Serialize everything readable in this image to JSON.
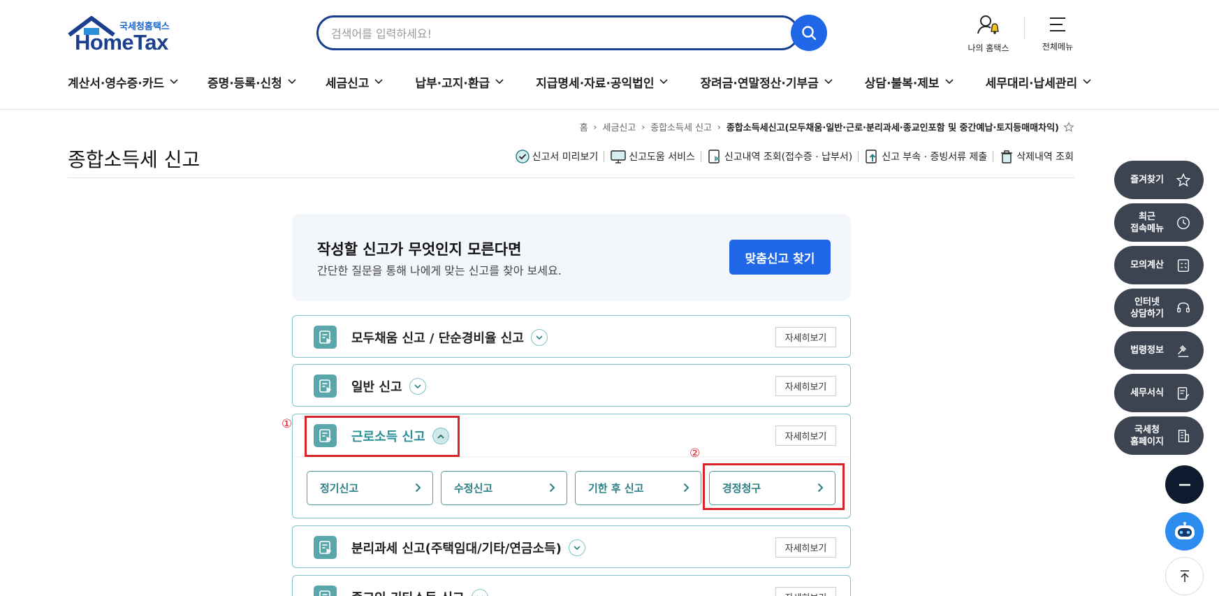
{
  "header": {
    "logo_sub": "국세청홈택스",
    "logo_main": "HomeTax",
    "search_placeholder": "검색어를 입력하세요!",
    "my_hometax": "나의 홈택스",
    "all_menu": "전체메뉴"
  },
  "gnb": [
    "계산서·영수증·카드",
    "증명·등록·신청",
    "세금신고",
    "납부·고지·환급",
    "지급명세·자료·공익법인",
    "장려금·연말정산·기부금",
    "상담·불복·제보",
    "세무대리·납세관리"
  ],
  "breadcrumb": {
    "items": [
      "홈",
      "세금신고",
      "종합소득세 신고"
    ],
    "current": "종합소득세신고(모두채움·일반·근로·분리과세·종교인포함 및 중간예납·토지등매매차익)"
  },
  "page": {
    "title": "종합소득세 신고",
    "tools": [
      "신고서 미리보기",
      "신고도움 서비스",
      "신고내역 조회(접수증 · 납부서)",
      "신고 부속 · 증빙서류 제출",
      "삭제내역 조회"
    ]
  },
  "promo": {
    "title": "작성할 신고가 무엇인지 모른다면",
    "desc": "간단한 질문을 통해 나에게 맞는 신고를 찾아 보세요.",
    "button": "맞춤신고 찾기"
  },
  "accordion": {
    "detail_label": "자세히보기",
    "items": [
      {
        "title": "모두채움 신고 / 단순경비율 신고",
        "open": false
      },
      {
        "title": "일반 신고",
        "open": false
      },
      {
        "title": "근로소득 신고",
        "open": true,
        "sub": [
          "정기신고",
          "수정신고",
          "기한 후 신고",
          "경정청구"
        ]
      },
      {
        "title": "분리과세 신고(주택임대/기타/연금소득)",
        "open": false
      },
      {
        "title": "종교인 기타소득 신고",
        "open": false
      }
    ]
  },
  "annotations": {
    "mark1": "①",
    "mark2": "②",
    "color": "#d9232a"
  },
  "quick_menu": [
    "즐겨찾기",
    "최근\n접속메뉴",
    "모의계산",
    "인터넷\n상담하기",
    "법령정보",
    "세무서식",
    "국세청\n홈페이지"
  ],
  "colors": {
    "brand_blue": "#2067e8",
    "navy": "#1b3f8f",
    "teal": "#5aa7ab",
    "quick_bg": "#3d4451"
  }
}
